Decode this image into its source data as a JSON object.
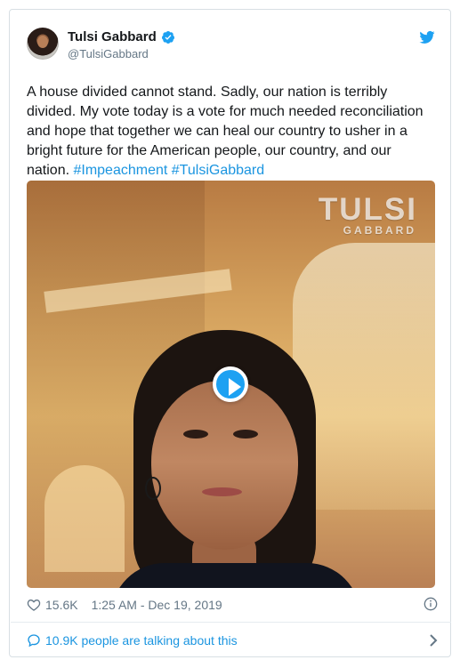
{
  "colors": {
    "verified": "#1da1f2",
    "link": "#1b95e0",
    "secondary_text": "#657786",
    "border": "#d8dfe4",
    "play_button": "#1da1f2"
  },
  "tweet": {
    "author": {
      "display_name": "Tulsi Gabbard",
      "handle": "@TulsiGabbard",
      "verified_icon": "verified-badge-icon",
      "avatar": "profile-photo"
    },
    "text_parts": [
      "A house divided cannot stand. Sadly, our nation is terribly divided. My vote today is a vote for much needed reconciliation and hope that together we can heal our country to usher in a bright future for the American people, our country, and our nation. ",
      "#Impeachment",
      " ",
      "#TulsiGabbard"
    ],
    "media": {
      "type": "video",
      "brand_title": "TULSI",
      "brand_subtitle": "GABBARD",
      "play_icon": "play-icon"
    },
    "stats": {
      "likes": "15.6K",
      "timestamp": "1:25 AM - Dec 19, 2019",
      "like_icon": "heart-icon",
      "info_icon": "info-icon"
    },
    "conversation": {
      "label": "10.9K people are talking about this",
      "icon": "conversation-icon",
      "chevron": "chevron-right-icon"
    }
  }
}
